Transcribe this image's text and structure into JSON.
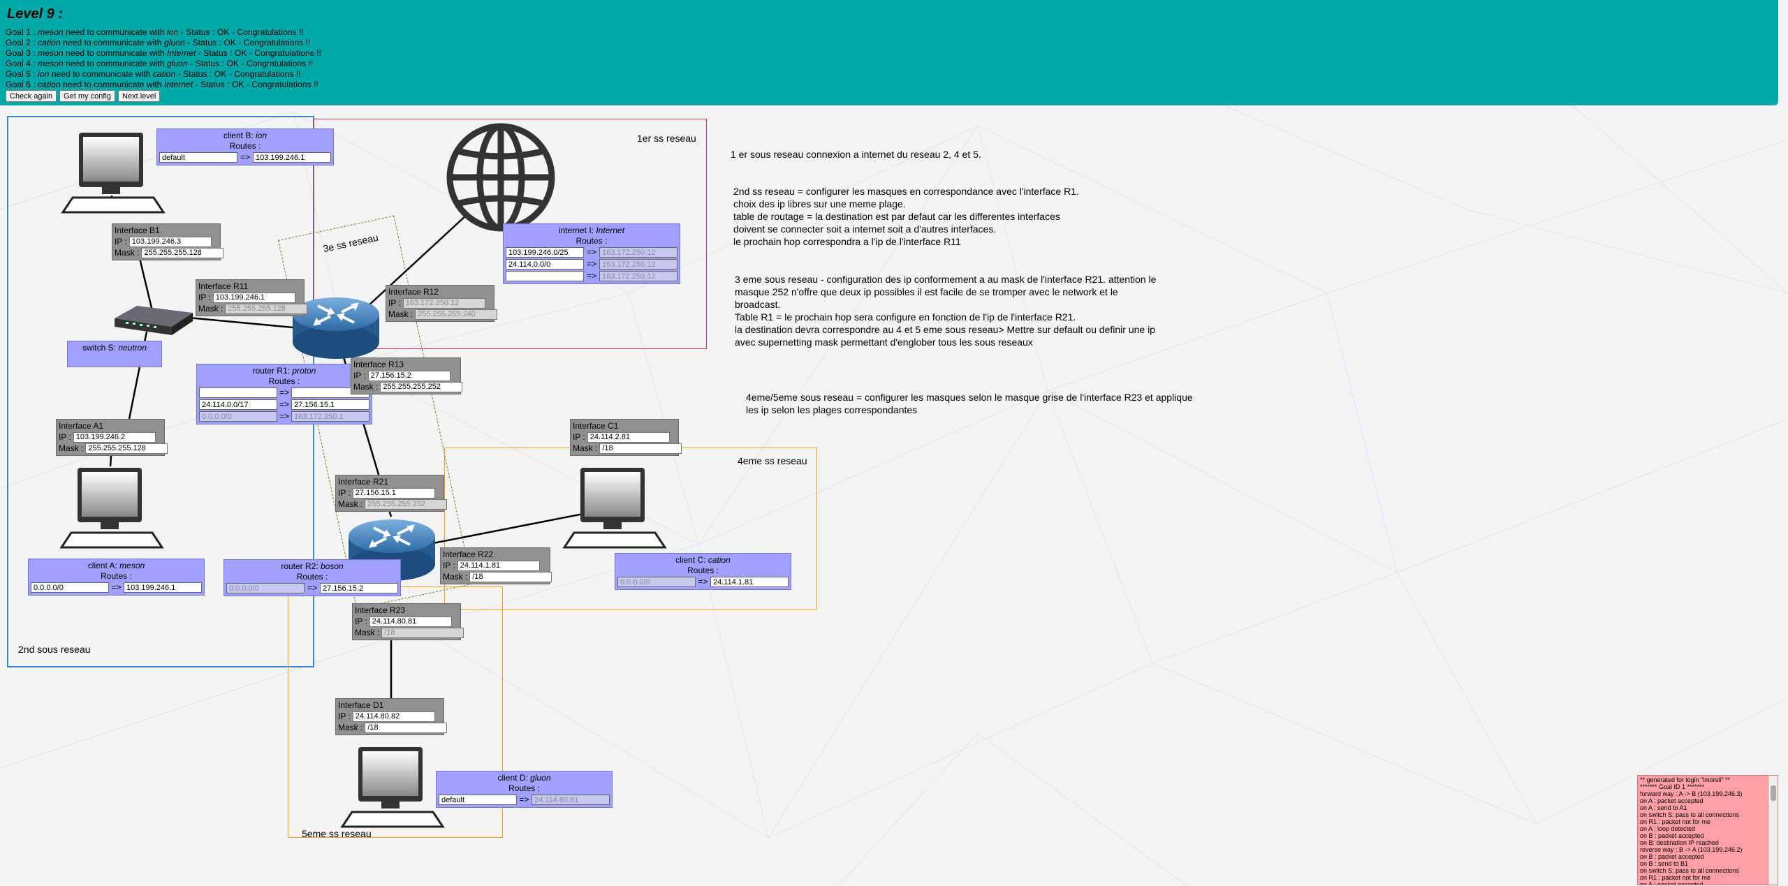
{
  "header": {
    "level_title": "Level 9 :",
    "goals": [
      {
        "prefix": "Goal 1 : ",
        "a": "meson",
        "mid": " need to communicate with ",
        "b": "ion",
        "suffix": " - Status : OK - Congratulations !!"
      },
      {
        "prefix": "Goal 2 : ",
        "a": "cation",
        "mid": " need to communicate with ",
        "b": "gluon",
        "suffix": " - Status : OK - Congratulations !!"
      },
      {
        "prefix": "Goal 3 : ",
        "a": "meson",
        "mid": " need to communicate with ",
        "b": "Internet",
        "suffix": " - Status : OK - Congratulations !!"
      },
      {
        "prefix": "Goal 4 : ",
        "a": "meson",
        "mid": " need to communicate with ",
        "b": "gluon",
        "suffix": " - Status : OK - Congratulations !!"
      },
      {
        "prefix": "Goal 5 : ",
        "a": "ion",
        "mid": " need to communicate with ",
        "b": "cation",
        "suffix": " - Status : OK - Congratulations !!"
      },
      {
        "prefix": "Goal 6 : ",
        "a": "cation",
        "mid": " need to communicate with ",
        "b": "Internet",
        "suffix": " - Status : OK - Congratulations !!"
      }
    ],
    "buttons": {
      "check": "Check again",
      "config": "Get my config",
      "next": "Next level"
    }
  },
  "labels": {
    "ip": "IP :",
    "mask": "Mask :",
    "routes": "Routes :",
    "arrow": "=>"
  },
  "regions": {
    "blue": "2nd sous reseau",
    "red": "1er ss reseau",
    "green": "3e ss reseau",
    "orange1": "4eme ss reseau",
    "orange2": "5eme ss reseau"
  },
  "interfaces": {
    "B1": {
      "title": "Interface B1",
      "ip": "103.199.246.3",
      "mask": "255.255.255.128"
    },
    "R11": {
      "title": "Interface R11",
      "ip": "103.199.246.1",
      "mask": "255.255.255.128"
    },
    "R12": {
      "title": "Interface R12",
      "ip": "163.172.250.12",
      "mask": "255.255.255.240"
    },
    "R13": {
      "title": "Interface R13",
      "ip": "27.156.15.2",
      "mask": "255.255.255.252"
    },
    "A1": {
      "title": "Interface A1",
      "ip": "103.199.246.2",
      "mask": "255.255.255.128"
    },
    "C1": {
      "title": "Interface C1",
      "ip": "24.114.2.81",
      "mask": "/18"
    },
    "R21": {
      "title": "Interface R21",
      "ip": "27.156.15.1",
      "mask": "255.255.255.252"
    },
    "R22": {
      "title": "Interface R22",
      "ip": "24.114.1.81",
      "mask": "/18"
    },
    "R23": {
      "title": "Interface R23",
      "ip": "24.114.80.81",
      "mask": "/18"
    },
    "D1": {
      "title": "Interface D1",
      "ip": "24.114.80.82",
      "mask": "/18"
    }
  },
  "devices": {
    "clientB": {
      "label": "client B: ",
      "name": "ion",
      "routes": [
        {
          "dest": "default",
          "hop": "103.199.246.1"
        }
      ]
    },
    "internet": {
      "label": "internet I: ",
      "name": "Internet",
      "routes": [
        {
          "dest": "103.199.246.0/25",
          "hop": "163.172.250.12"
        },
        {
          "dest": "24.114.0.0/0",
          "hop": "163.172.250.12"
        },
        {
          "dest": "",
          "hop": "163.172.250.12"
        }
      ]
    },
    "switchS": {
      "label": "switch S: ",
      "name": "neutron"
    },
    "routerR1": {
      "label": "router R1: ",
      "name": "proton",
      "routes": [
        {
          "dest": "",
          "hop": ""
        },
        {
          "dest": "24.114.0.0/17",
          "hop": "27.156.15.1"
        },
        {
          "dest": "0.0.0.0/0",
          "hop": "163.172.250.1"
        }
      ]
    },
    "clientA": {
      "label": "client A: ",
      "name": "meson",
      "routes": [
        {
          "dest": "0.0.0.0/0",
          "hop": "103.199.246.1"
        }
      ]
    },
    "routerR2": {
      "label": "router R2: ",
      "name": "boson",
      "routes": [
        {
          "dest": "0.0.0.0/0",
          "hop": "27.156.15.2"
        }
      ]
    },
    "clientC": {
      "label": "client C: ",
      "name": "cation",
      "routes": [
        {
          "dest": "0.0.0.0/0",
          "hop": "24.114.1.81"
        }
      ]
    },
    "clientD": {
      "label": "client D: ",
      "name": "gluon",
      "routes": [
        {
          "dest": "default",
          "hop": "24.114.80.81"
        }
      ]
    }
  },
  "notes": {
    "n1": "1 er sous reseau connexion a internet du reseau 2, 4 et 5.",
    "n2": [
      "2nd ss reseau = configurer les masques en correspondance avec l'interface R1.",
      "choix des ip libres sur une meme plage.",
      "table de routage = la destination est par defaut car les differentes interfaces",
      "doivent se connecter soit a internet soit a d'autres interfaces.",
      "le prochain hop correspondra a l'ip de l'interface R11"
    ],
    "n3": [
      "3 eme sous reseau - configuration des ip conformement a au mask de l'interface R21. attention le",
      "masque 252 n'offre que deux ip possibles il est facile de se tromper avec le network et le",
      "broadcast.",
      "Table R1 = le prochain hop sera configure en fonction de l'ip de l'interface R21.",
      "la destination devra correspondre au 4 et 5 eme sous reseau> Mettre sur default ou definir une ip",
      "avec supernetting mask permettant d'englober tous les sous reseaux"
    ],
    "n4": [
      "4eme/5eme sous reseau = configurer les masques selon le masque grise de l'interface R23 et applique",
      "les ip selon les plages correspondantes"
    ]
  },
  "log_lines": [
    "** generated for login \"lmorsli\" **",
    "******* Goal ID 1 *******",
    "forward way : A -> B (103.199.246.3)",
    "on A : packet accepted",
    "on A : send to A1",
    "on switch S: pass to all connections",
    "on R1 : packet not for me",
    "on A : loop detected",
    "on B : packet accepted",
    "on B: destination IP reached",
    "reverse way : B -> A (103.199.246.2)",
    "on B : packet accepted",
    "on B : send to B1",
    "on switch S: pass to all connections",
    "on R1 : packet not for me",
    "on A : packet accepted"
  ],
  "colors": {
    "header": "#00a8a8",
    "interface": "#909090",
    "device": "#a0a0ff",
    "log": "#ff9fa6",
    "blue": "#3a86d8",
    "red": "#e0304a",
    "green": "#5a8a20",
    "orange": "#f0a020"
  }
}
